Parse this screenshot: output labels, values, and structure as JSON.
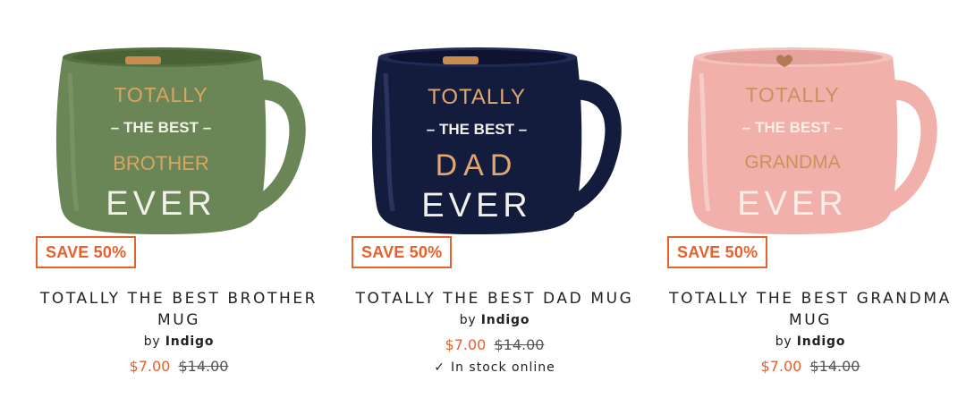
{
  "colors": {
    "accent": "#e8602c",
    "mug_green": "#6a8556",
    "mug_navy": "#141c3e",
    "mug_pink": "#f1b0aa"
  },
  "products": [
    {
      "badge": "SAVE 50%",
      "title": "TOTALLY THE BEST BROTHER MUG",
      "by": "by",
      "brand": "Indigo",
      "sale_price": "$7.00",
      "original_price": "$14.00",
      "mug_text": [
        "TOTALLY",
        "– THE BEST –",
        "BROTHER",
        "EVER"
      ]
    },
    {
      "badge": "SAVE 50%",
      "title": "TOTALLY THE BEST DAD MUG",
      "by": "by",
      "brand": "Indigo",
      "sale_price": "$7.00",
      "original_price": "$14.00",
      "stock": "In stock online",
      "stock_icon": "check-icon",
      "mug_text": [
        "TOTALLY",
        "– THE BEST –",
        "DAD",
        "EVER"
      ]
    },
    {
      "badge": "SAVE 50%",
      "title": "TOTALLY THE BEST GRANDMA MUG",
      "by": "by",
      "brand": "Indigo",
      "sale_price": "$7.00",
      "original_price": "$14.00",
      "mug_text": [
        "TOTALLY",
        "– THE BEST –",
        "GRANDMA",
        "EVER"
      ]
    }
  ]
}
